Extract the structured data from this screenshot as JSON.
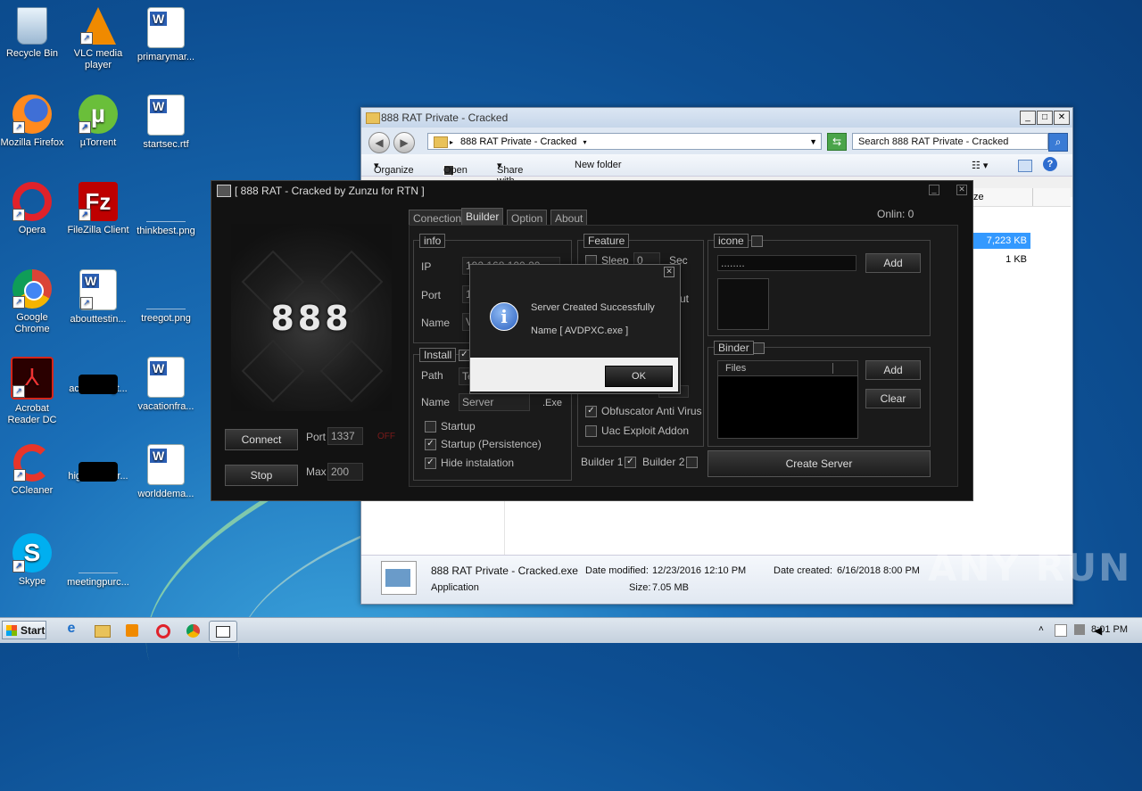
{
  "desktop": {
    "icons": [
      {
        "label": "Recycle Bin"
      },
      {
        "label": "VLC media player"
      },
      {
        "label": "primarymar..."
      },
      {
        "label": "Mozilla Firefox"
      },
      {
        "label": "µTorrent"
      },
      {
        "label": "startsec.rtf"
      },
      {
        "label": "Opera"
      },
      {
        "label": "FileZilla Client"
      },
      {
        "label": "thinkbest.png"
      },
      {
        "label": "Google Chrome"
      },
      {
        "label": "abouttestin..."
      },
      {
        "label": "treegot.png"
      },
      {
        "label": "Acrobat Reader DC"
      },
      {
        "label": "accountingt..."
      },
      {
        "label": "vacationfra..."
      },
      {
        "label": "CCleaner"
      },
      {
        "label": "highermotor..."
      },
      {
        "label": "worlddema..."
      },
      {
        "label": "Skype"
      },
      {
        "label": "meetingpurc..."
      }
    ]
  },
  "explorer": {
    "title": "888 RAT Private - Cracked",
    "address": "888 RAT Private - Cracked",
    "search_placeholder": "Search 888 RAT Private - Cracked",
    "toolbar": {
      "organize": "Organize",
      "open": "Open",
      "share_with": "Share with",
      "new_folder": "New folder"
    },
    "column_size": "ze",
    "rows": [
      {
        "size": "7,223 KB"
      },
      {
        "size": "1 KB"
      }
    ],
    "status": {
      "filename": "888 RAT Private - Cracked.exe",
      "type": "Application",
      "date_modified_label": "Date modified:",
      "date_modified": "12/23/2016 12:10 PM",
      "date_created_label": "Date created:",
      "date_created": "6/16/2018 8:00 PM",
      "size_label": "Size:",
      "size": "7.05 MB"
    }
  },
  "rat": {
    "title": "[ 888 RAT - Cracked by Zunzu for RTN ]",
    "logo_text": "888",
    "online": "Onlin:  0",
    "connect_label": "Connect",
    "stop_label": "Stop",
    "port_label": "Port",
    "port_value": "1337",
    "off_label": "OFF",
    "max_label": "Max",
    "max_value": "200",
    "tabs": [
      "Conection",
      "Builder",
      "Option",
      "About"
    ],
    "info": {
      "title": "info",
      "ip_label": "IP",
      "ip_value": "192.168.100.20",
      "port_label": "Port",
      "port_value": "1",
      "name_label": "Name",
      "name_value": "V"
    },
    "install": {
      "title": "Install",
      "path_label": "Path",
      "path_value": "Te",
      "name_label": "Name",
      "name_value": "Server",
      "ext": ".Exe",
      "startup": "Startup",
      "startup_persistence": "Startup (Persistence)",
      "hide": "Hide instalation"
    },
    "feature": {
      "title": "Feature",
      "sleep": "Sleep",
      "sleep_value": "0",
      "sec": "Sec",
      "ut": "ut",
      "obfuscator": "Obfuscator Anti Virus",
      "uac": "Uac Exploit Addon",
      "builder1": "Builder 1",
      "builder2": "Builder 2"
    },
    "icone": {
      "title": "icone",
      "path": "........",
      "add": "Add"
    },
    "binder": {
      "title": "Binder",
      "files_header": "Files",
      "add": "Add",
      "clear": "Clear"
    },
    "create_server": "Create Server"
  },
  "dialog": {
    "message": "Server Created Successfully",
    "name_line": "Name [ AVDPXC.exe ]",
    "ok": "OK"
  },
  "taskbar": {
    "start": "Start",
    "time": "8:01 PM"
  },
  "watermark": "ANY RUN"
}
